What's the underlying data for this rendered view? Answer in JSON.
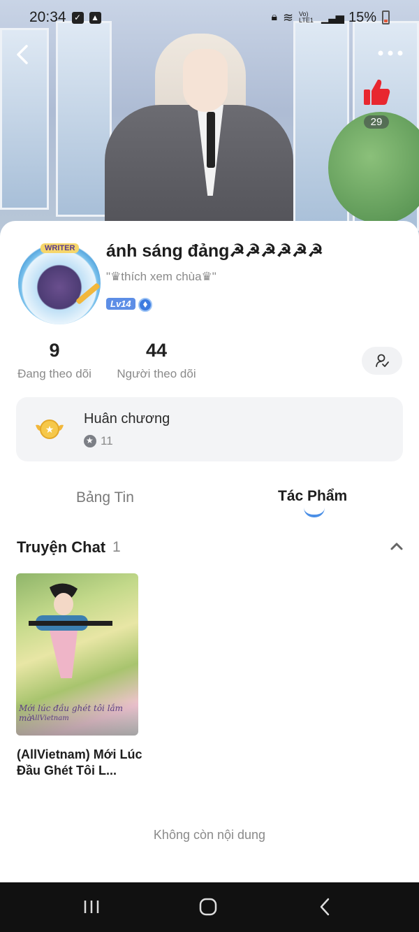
{
  "status_bar": {
    "time": "20:34",
    "network": "Vo) LTE1",
    "battery": "15%"
  },
  "header": {
    "like_count": "29",
    "colors": {
      "like": "#e8272f"
    }
  },
  "profile": {
    "name": "ánh sáng đảng☭☭☭☭☭☭",
    "bio": "\"♛thích xem chùa♛\"",
    "avatar_badge": "WRITER",
    "level": "Lv14"
  },
  "stats": {
    "following": {
      "value": "9",
      "label": "Đang theo dõi"
    },
    "followers": {
      "value": "44",
      "label": "Người theo dõi"
    }
  },
  "medal": {
    "title": "Huân chương",
    "count": "11"
  },
  "tabs": [
    {
      "label": "Bảng Tin",
      "active": false
    },
    {
      "label": "Tác Phẩm",
      "active": true
    }
  ],
  "section": {
    "title": "Truyện Chat",
    "count": "1"
  },
  "stories": [
    {
      "title": "(AllVietnam) Mới Lúc Đầu Ghét Tôi L...",
      "cover_text": "Mới lúc đầu ghét tôi lắm mà",
      "cover_subtext": "AllVietnam"
    }
  ],
  "end_note": "Không còn nội dung",
  "accent_color": "#4b8fe6"
}
